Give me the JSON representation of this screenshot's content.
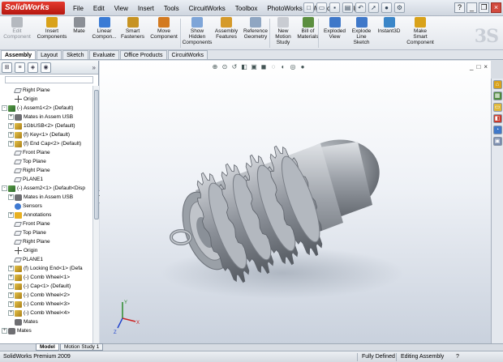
{
  "app": {
    "logo": "SolidWorks"
  },
  "menu": [
    "File",
    "Edit",
    "View",
    "Insert",
    "Tools",
    "CircuitWorks",
    "Toolbox",
    "PhotoWorks",
    "Window",
    "Help"
  ],
  "ribbon": [
    {
      "id": "edit-component",
      "label": "Edit\nComponent",
      "icon": "edit-component-icon",
      "color": "#b5b9bf",
      "dim": true
    },
    {
      "id": "insert-components",
      "label": "Insert\nComponents",
      "icon": "insert-components-icon",
      "color": "#d9a21a"
    },
    {
      "id": "mate",
      "label": "Mate",
      "icon": "paperclip-icon",
      "color": "#8b8f96"
    },
    {
      "id": "linear-component",
      "label": "Linear\nCompon...",
      "icon": "linear-pattern-icon",
      "color": "#3a7bd5"
    },
    {
      "id": "smart-fasteners",
      "label": "Smart\nFasteners",
      "icon": "fastener-icon",
      "color": "#c79322"
    },
    {
      "id": "move-component",
      "label": "Move\nComponent",
      "icon": "move-component-icon",
      "color": "#d37a20"
    },
    {
      "id": "show-hidden",
      "label": "Show\nHidden\nComponents",
      "icon": "show-hidden-icon",
      "color": "#7ea5d8"
    },
    {
      "id": "assembly-features",
      "label": "Assembly\nFeatures",
      "icon": "assembly-features-icon",
      "color": "#d59a2a"
    },
    {
      "id": "reference-geometry",
      "label": "Reference\nGeometry",
      "icon": "reference-geometry-icon",
      "color": "#8fa6c2"
    },
    {
      "id": "new-motion-study",
      "label": "New\nMotion\nStudy",
      "icon": "motion-study-icon",
      "color": "#c9ccd2"
    },
    {
      "id": "bill-of-materials",
      "label": "Bill of\nMaterials",
      "icon": "bom-icon",
      "color": "#5c8f3f"
    },
    {
      "id": "exploded-view",
      "label": "Exploded\nView",
      "icon": "exploded-view-icon",
      "color": "#3f78c9"
    },
    {
      "id": "explode-line-sketch",
      "label": "Explode\nLine\nSketch",
      "icon": "explode-line-icon",
      "color": "#3f78c9"
    },
    {
      "id": "instant3d",
      "label": "Instant3D",
      "icon": "instant3d-icon",
      "color": "#3b86c8"
    },
    {
      "id": "make-smart-component",
      "label": "Make\nSmart\nComponent",
      "icon": "smart-component-icon",
      "color": "#d9a21a"
    }
  ],
  "cmd_tabs": [
    "Assembly",
    "Layout",
    "Sketch",
    "Evaluate",
    "Office Products",
    "CircuitWorks"
  ],
  "active_cmd_tab": "Assembly",
  "tree": [
    {
      "label": "Right Plane",
      "icon": "plane",
      "indent": 1,
      "toggle": ""
    },
    {
      "label": "Origin",
      "icon": "origin",
      "indent": 1,
      "toggle": ""
    },
    {
      "label": "(-) Assem1<2> (Default)",
      "icon": "asm",
      "indent": 0,
      "toggle": "-"
    },
    {
      "label": "Mates in Assem USB",
      "icon": "mate",
      "indent": 1,
      "toggle": "+"
    },
    {
      "label": "1GbUSB<2> (Default)",
      "icon": "part",
      "indent": 1,
      "toggle": "+"
    },
    {
      "label": "(f) Key<1> (Default)",
      "icon": "part",
      "indent": 1,
      "toggle": "+"
    },
    {
      "label": "(f) End Cap<2> (Default)",
      "icon": "part",
      "indent": 1,
      "toggle": "+"
    },
    {
      "label": "Front Plane",
      "icon": "plane",
      "indent": 1,
      "toggle": ""
    },
    {
      "label": "Top Plane",
      "icon": "plane",
      "indent": 1,
      "toggle": ""
    },
    {
      "label": "Right Plane",
      "icon": "plane",
      "indent": 1,
      "toggle": ""
    },
    {
      "label": "PLANE1",
      "icon": "plane",
      "indent": 1,
      "toggle": ""
    },
    {
      "label": "(-) Assem2<1> (Default<Disp",
      "icon": "asm",
      "indent": 0,
      "toggle": "-"
    },
    {
      "label": "Mates in Assem USB",
      "icon": "mate",
      "indent": 1,
      "toggle": "+"
    },
    {
      "label": "Sensors",
      "icon": "sens",
      "indent": 1,
      "toggle": ""
    },
    {
      "label": "Annotations",
      "icon": "annot",
      "indent": 1,
      "toggle": "+"
    },
    {
      "label": "Front Plane",
      "icon": "plane",
      "indent": 1,
      "toggle": ""
    },
    {
      "label": "Top Plane",
      "icon": "plane",
      "indent": 1,
      "toggle": ""
    },
    {
      "label": "Right Plane",
      "icon": "plane",
      "indent": 1,
      "toggle": ""
    },
    {
      "label": "Origin",
      "icon": "origin",
      "indent": 1,
      "toggle": ""
    },
    {
      "label": "PLANE1",
      "icon": "plane",
      "indent": 1,
      "toggle": ""
    },
    {
      "label": "(f) Locking End<1> (Defa",
      "icon": "part",
      "indent": 1,
      "toggle": "+"
    },
    {
      "label": "(-) Comb Wheel<1>",
      "icon": "part",
      "indent": 1,
      "toggle": "+"
    },
    {
      "label": "(-) Cap<1> (Default)",
      "icon": "part",
      "indent": 1,
      "toggle": "+"
    },
    {
      "label": "(-) Comb Wheel<2>",
      "icon": "part",
      "indent": 1,
      "toggle": "+"
    },
    {
      "label": "(-) Comb Wheel<3>",
      "icon": "part",
      "indent": 1,
      "toggle": "+"
    },
    {
      "label": "(-) Comb Wheel<4>",
      "icon": "part",
      "indent": 1,
      "toggle": "+"
    },
    {
      "label": "Mates",
      "icon": "mate",
      "indent": 1,
      "toggle": ""
    },
    {
      "label": "Mates",
      "icon": "mate",
      "indent": 0,
      "toggle": "+"
    }
  ],
  "bottom_tabs": [
    "Model",
    "Motion Study 1"
  ],
  "status": {
    "product": "SolidWorks Premium 2009",
    "state": "Fully Defined",
    "mode": "Editing Assembly"
  },
  "colors": {
    "part_body": "#8f949c",
    "accent": "#3f78c9"
  }
}
